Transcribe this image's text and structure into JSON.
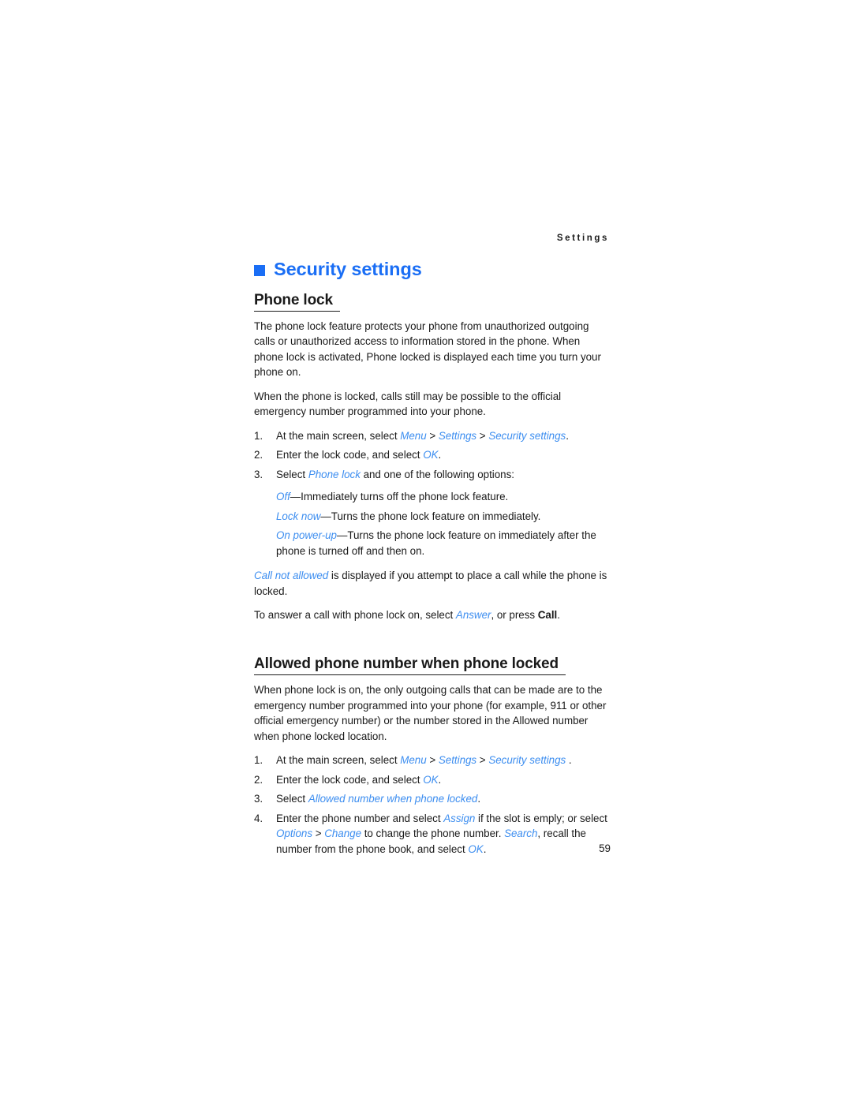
{
  "page": {
    "running_header": "Settings",
    "page_number": "59",
    "accent_color": "#1a6ef5",
    "ui_term_color": "#3d8ef0",
    "text_color": "#1a1a1a"
  },
  "chapter": {
    "bullet_icon": "square-bullet-icon",
    "title": "Security settings"
  },
  "sections": [
    {
      "heading": "Phone lock",
      "paragraphs": [
        "The phone lock feature protects your phone from unauthorized outgoing calls or unauthorized access to information stored in the phone. When phone lock is activated, Phone locked is displayed each time you turn your phone on.",
        "When the phone is locked, calls still may be possible to the official emergency number programmed into your phone."
      ],
      "steps": [
        {
          "num": "1.",
          "parts": [
            {
              "t": "At the main screen, select ",
              "s": "plain"
            },
            {
              "t": "Menu",
              "s": "ui"
            },
            {
              "t": " > ",
              "s": "sep"
            },
            {
              "t": "Settings",
              "s": "ui"
            },
            {
              "t": " > ",
              "s": "sep"
            },
            {
              "t": "Security settings",
              "s": "ui"
            },
            {
              "t": ".",
              "s": "plain"
            }
          ]
        },
        {
          "num": "2.",
          "parts": [
            {
              "t": "Enter the lock code, and select ",
              "s": "plain"
            },
            {
              "t": "OK",
              "s": "ui"
            },
            {
              "t": ".",
              "s": "plain"
            }
          ]
        },
        {
          "num": "3.",
          "parts": [
            {
              "t": "Select ",
              "s": "plain"
            },
            {
              "t": "Phone lock",
              "s": "ui"
            },
            {
              "t": " and one of the following options:",
              "s": "plain"
            }
          ]
        }
      ],
      "options": [
        {
          "parts": [
            {
              "t": "Off",
              "s": "ui"
            },
            {
              "t": "—Immediately turns off the phone lock feature.",
              "s": "plain"
            }
          ]
        },
        {
          "parts": [
            {
              "t": "Lock now",
              "s": "ui"
            },
            {
              "t": "—Turns the phone lock feature on immediately.",
              "s": "plain"
            }
          ]
        },
        {
          "parts": [
            {
              "t": "On power-up",
              "s": "ui"
            },
            {
              "t": "—Turns the phone lock feature on immediately after the phone is turned off and then on.",
              "s": "plain"
            }
          ]
        }
      ],
      "closing_paragraphs": [
        {
          "parts": [
            {
              "t": "Call not allowed",
              "s": "ui"
            },
            {
              "t": " is displayed if you attempt to place a call while the phone is locked.",
              "s": "plain"
            }
          ]
        },
        {
          "parts": [
            {
              "t": "To answer a call with phone lock on, select ",
              "s": "plain"
            },
            {
              "t": "Answer",
              "s": "ui"
            },
            {
              "t": ", or press ",
              "s": "plain"
            },
            {
              "t": "Call",
              "s": "key"
            },
            {
              "t": ".",
              "s": "plain"
            }
          ]
        }
      ]
    },
    {
      "heading": "Allowed phone number when phone locked",
      "paragraphs": [
        "When phone lock is on, the only outgoing calls that can be made are to the emergency number programmed into your phone (for example, 911 or other official emergency number) or the number stored in the Allowed number when phone locked location."
      ],
      "steps": [
        {
          "num": "1.",
          "parts": [
            {
              "t": "At the main screen, select ",
              "s": "plain"
            },
            {
              "t": "Menu",
              "s": "ui"
            },
            {
              "t": " > ",
              "s": "sep"
            },
            {
              "t": "Settings",
              "s": "ui"
            },
            {
              "t": " > ",
              "s": "sep"
            },
            {
              "t": "Security settings",
              "s": "ui"
            },
            {
              "t": " .",
              "s": "plain"
            }
          ]
        },
        {
          "num": "2.",
          "parts": [
            {
              "t": "Enter the lock code, and select ",
              "s": "plain"
            },
            {
              "t": "OK",
              "s": "ui"
            },
            {
              "t": ".",
              "s": "plain"
            }
          ]
        },
        {
          "num": "3.",
          "parts": [
            {
              "t": "Select ",
              "s": "plain"
            },
            {
              "t": "Allowed number when phone locked",
              "s": "ui"
            },
            {
              "t": ".",
              "s": "plain"
            }
          ]
        },
        {
          "num": "4.",
          "parts": [
            {
              "t": "Enter the phone number and select ",
              "s": "plain"
            },
            {
              "t": "Assign",
              "s": "ui"
            },
            {
              "t": " if the slot is emply; or select ",
              "s": "plain"
            },
            {
              "t": "Options",
              "s": "ui"
            },
            {
              "t": " > ",
              "s": "sep"
            },
            {
              "t": "Change",
              "s": "ui"
            },
            {
              "t": " to change the phone number. ",
              "s": "plain"
            },
            {
              "t": "Search",
              "s": "ui"
            },
            {
              "t": ", recall the number from the phone book, and select ",
              "s": "plain"
            },
            {
              "t": "OK",
              "s": "ui"
            },
            {
              "t": ".",
              "s": "plain"
            }
          ]
        }
      ]
    }
  ]
}
